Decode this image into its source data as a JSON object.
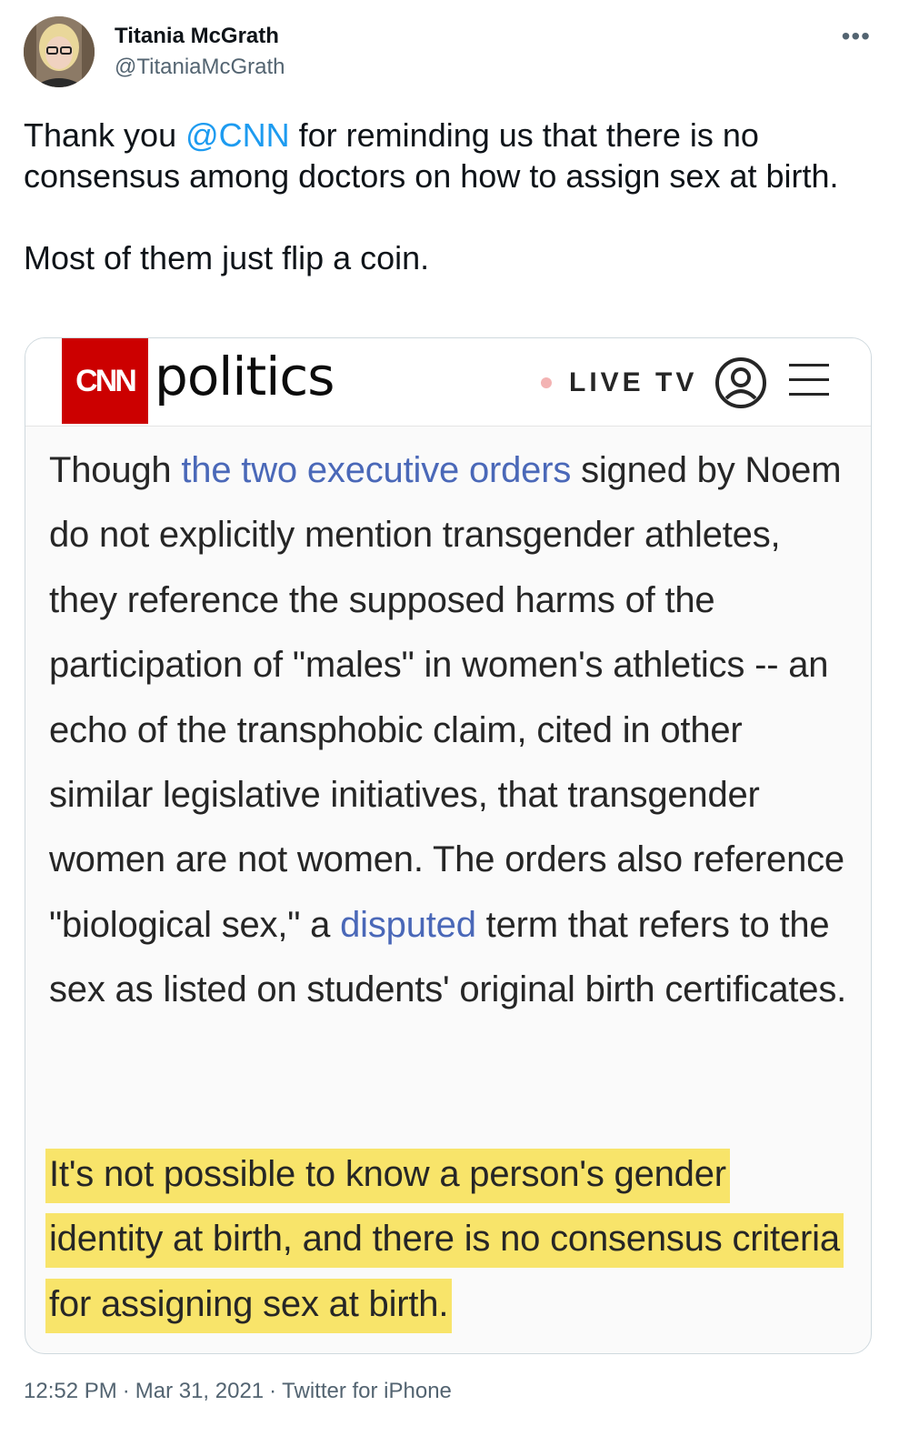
{
  "tweet": {
    "author_name": "Titania McGrath",
    "author_handle": "@TitaniaMcGrath",
    "more_glyph": "•••",
    "text_before": "Thank you ",
    "mention": "@CNN",
    "text_after": " for reminding us that there is no consensus among doctors on how to assign sex at birth.",
    "text_second": "Most of them just flip a coin.",
    "time": "12:52 PM",
    "date": "Mar 31, 2021",
    "source": "Twitter for iPhone",
    "separator": "·"
  },
  "card": {
    "logo_text": "CNN",
    "section": "politics",
    "live_label": "LIVE TV",
    "article": {
      "part1": "Though ",
      "link1": "the two executive orders",
      "part2": " signed by Noem do not explicitly mention transgender athletes, they reference the supposed harms of the participation of \"males\" in women's athletics -- an echo of the transphobic claim, cited in other similar legislative initiatives, that transgender women are not women. The orders also reference \"biological sex,\" a ",
      "link2": "disputed",
      "part3": " term that refers to the sex as listed on students' original birth certificates."
    },
    "highlight": "It's not possible to know a person's gender identity at birth, and there is no consensus criteria for assigning sex at birth.",
    "colors": {
      "brand": "#cc0000",
      "link": "#4a68b8",
      "highlight": "#f8e46a",
      "mention": "#1d9bf0"
    }
  },
  "icons": {
    "avatar": "avatar-photo",
    "user": "user-circle-icon",
    "menu": "hamburger-menu-icon",
    "more": "more-dots-icon"
  }
}
